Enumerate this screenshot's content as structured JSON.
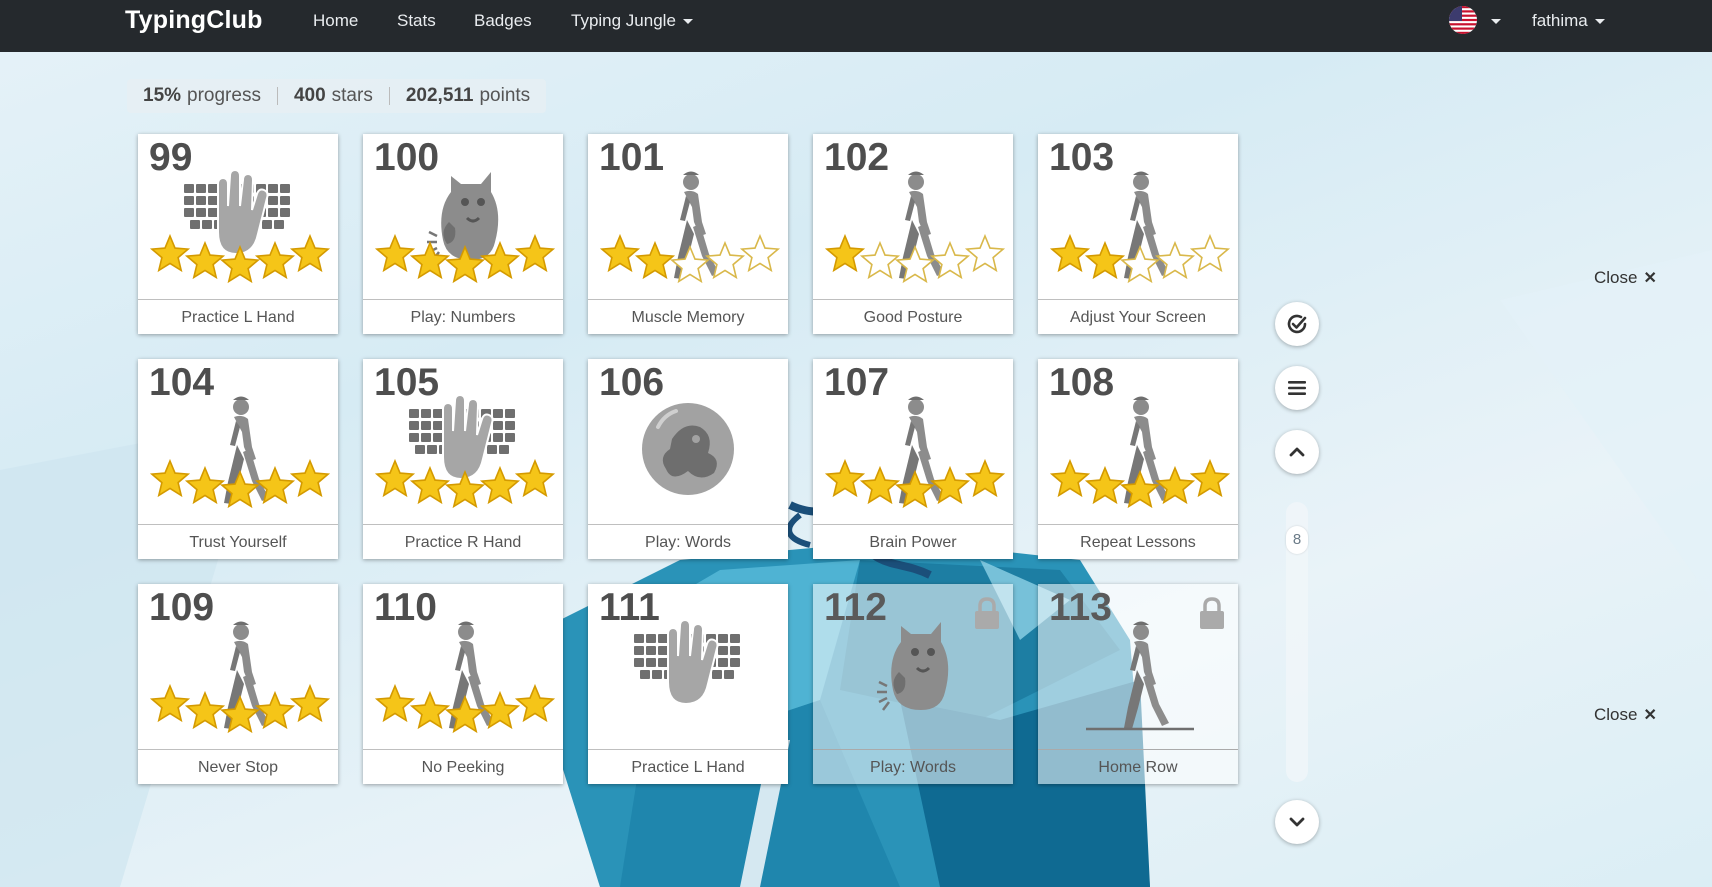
{
  "nav": {
    "brand": "TypingClub",
    "links": [
      "Home",
      "Stats",
      "Badges",
      "Typing Jungle"
    ],
    "user": "fathima"
  },
  "progress": {
    "percent": "15%",
    "percent_label": "progress",
    "stars": "400",
    "stars_label": "stars",
    "points": "202,511",
    "points_label": "points"
  },
  "lessons": [
    {
      "num": "99",
      "title": "Practice L Hand",
      "icon": "keyboard-hand-icon",
      "stars": 5,
      "locked": false
    },
    {
      "num": "100",
      "title": "Play: Numbers",
      "icon": "monster-icon",
      "stars": 5,
      "locked": false
    },
    {
      "num": "101",
      "title": "Muscle Memory",
      "icon": "walking-man-icon",
      "stars": 2,
      "locked": false
    },
    {
      "num": "102",
      "title": "Good Posture",
      "icon": "walking-man-icon",
      "stars": 1,
      "locked": false
    },
    {
      "num": "103",
      "title": "Adjust Your Screen",
      "icon": "walking-man-icon",
      "stars": 2,
      "locked": false
    },
    {
      "num": "104",
      "title": "Trust Yourself",
      "icon": "walking-man-icon",
      "stars": 5,
      "locked": false
    },
    {
      "num": "105",
      "title": "Practice R Hand",
      "icon": "keyboard-hand-icon",
      "stars": 5,
      "locked": false
    },
    {
      "num": "106",
      "title": "Play: Words",
      "icon": "bubble-creature-icon",
      "stars": 0,
      "locked": false
    },
    {
      "num": "107",
      "title": "Brain Power",
      "icon": "walking-man-icon",
      "stars": 5,
      "locked": false
    },
    {
      "num": "108",
      "title": "Repeat Lessons",
      "icon": "walking-man-icon",
      "stars": 5,
      "locked": false
    },
    {
      "num": "109",
      "title": "Never Stop",
      "icon": "walking-man-icon",
      "stars": 5,
      "locked": false
    },
    {
      "num": "110",
      "title": "No Peeking",
      "icon": "walking-man-icon",
      "stars": 5,
      "locked": false
    },
    {
      "num": "111",
      "title": "Practice L Hand",
      "icon": "keyboard-hand-icon",
      "stars": 0,
      "locked": false
    },
    {
      "num": "112",
      "title": "Play: Words",
      "icon": "monster-icon",
      "stars": 0,
      "locked": true
    },
    {
      "num": "113",
      "title": "Home Row",
      "icon": "walking-man-icon",
      "stars": 0,
      "locked": true
    }
  ],
  "controls": {
    "close_label": "Close",
    "close_symbol": "✕",
    "page": "8"
  },
  "colors": {
    "navbar": "#25292d",
    "star_fill": "#f5c518",
    "icon_gray": "#8c8c8c"
  }
}
